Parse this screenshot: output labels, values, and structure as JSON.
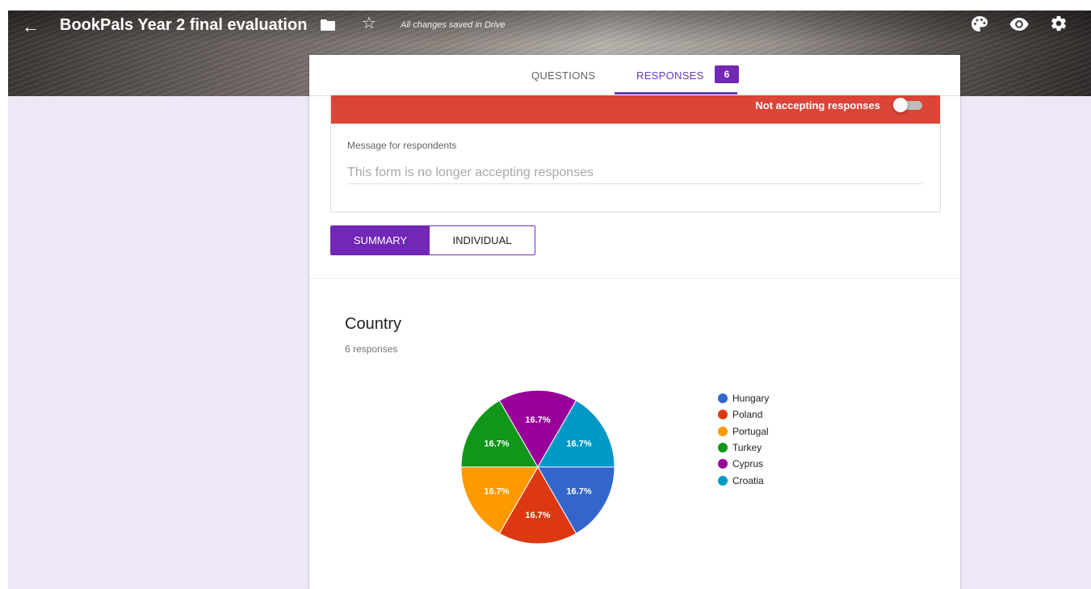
{
  "header": {
    "title": "BookPals Year 2 final evaluation",
    "save_status": "All changes saved in Drive",
    "icons": [
      "back-arrow-icon",
      "folder-icon",
      "star-icon",
      "palette-icon",
      "eye-icon",
      "gear-icon"
    ]
  },
  "tabs": {
    "questions_label": "QUESTIONS",
    "responses_label": "RESPONSES",
    "responses_count": "6",
    "active": "responses"
  },
  "responses_panel": {
    "accepting_label": "Not accepting responses",
    "accepting": false,
    "message_label": "Message for respondents",
    "message_placeholder": "This form is no longer accepting responses"
  },
  "view": {
    "summary_label": "SUMMARY",
    "individual_label": "INDIVIDUAL",
    "active": "summary"
  },
  "question": {
    "title": "Country",
    "count_text": "6 responses"
  },
  "colors": {
    "accent": "#7227b6",
    "banner_red": "#db4437",
    "page_bg": "#ede7f6"
  },
  "chart_data": {
    "type": "pie",
    "categories": [
      "Hungary",
      "Poland",
      "Portugal",
      "Turkey",
      "Cyprus",
      "Croatia"
    ],
    "values": [
      1,
      1,
      1,
      1,
      1,
      1
    ],
    "labels": [
      "16.7%",
      "16.7%",
      "16.7%",
      "16.7%",
      "16.7%",
      "16.7%"
    ],
    "colors": [
      "#3366cc",
      "#dc3912",
      "#ff9900",
      "#109618",
      "#990099",
      "#0099c6"
    ],
    "legend_placement": "right"
  }
}
